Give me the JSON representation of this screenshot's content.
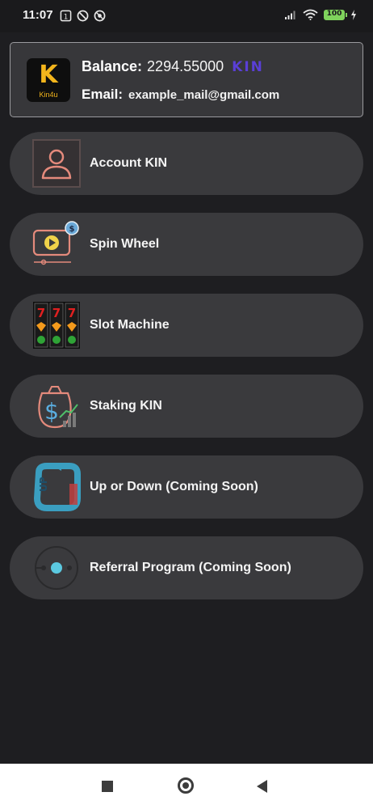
{
  "status_bar": {
    "time": "11:07",
    "battery": "100",
    "icons": [
      "notification-1-icon",
      "do-not-disturb-icon",
      "vpn-icon",
      "signal-icon",
      "wifi-icon",
      "battery-icon",
      "charging-icon"
    ]
  },
  "header": {
    "logo_text": "Kin4u",
    "logo_letter": "K",
    "balance_label": "Balance:",
    "balance_value": "2294.55000",
    "currency": "KIN",
    "email_label": "Email:",
    "email_value": "example_mail@gmail.com"
  },
  "menu": [
    {
      "label": "Account KIN",
      "icon": "account-icon"
    },
    {
      "label": "Spin Wheel",
      "icon": "spin-wheel-icon"
    },
    {
      "label": "Slot Machine",
      "icon": "slot-machine-icon"
    },
    {
      "label": "Staking KIN",
      "icon": "staking-icon"
    },
    {
      "label": "Up or Down (Coming Soon)",
      "icon": "up-or-down-icon"
    },
    {
      "label": "Referral Program (Coming Soon)",
      "icon": "referral-icon"
    }
  ],
  "colors": {
    "background": "#1e1e21",
    "card": "#3a3a3d",
    "accent": "#5a3fd6",
    "logo": "#f3b51c"
  },
  "nav": {
    "buttons": [
      "recents",
      "home",
      "back"
    ]
  }
}
